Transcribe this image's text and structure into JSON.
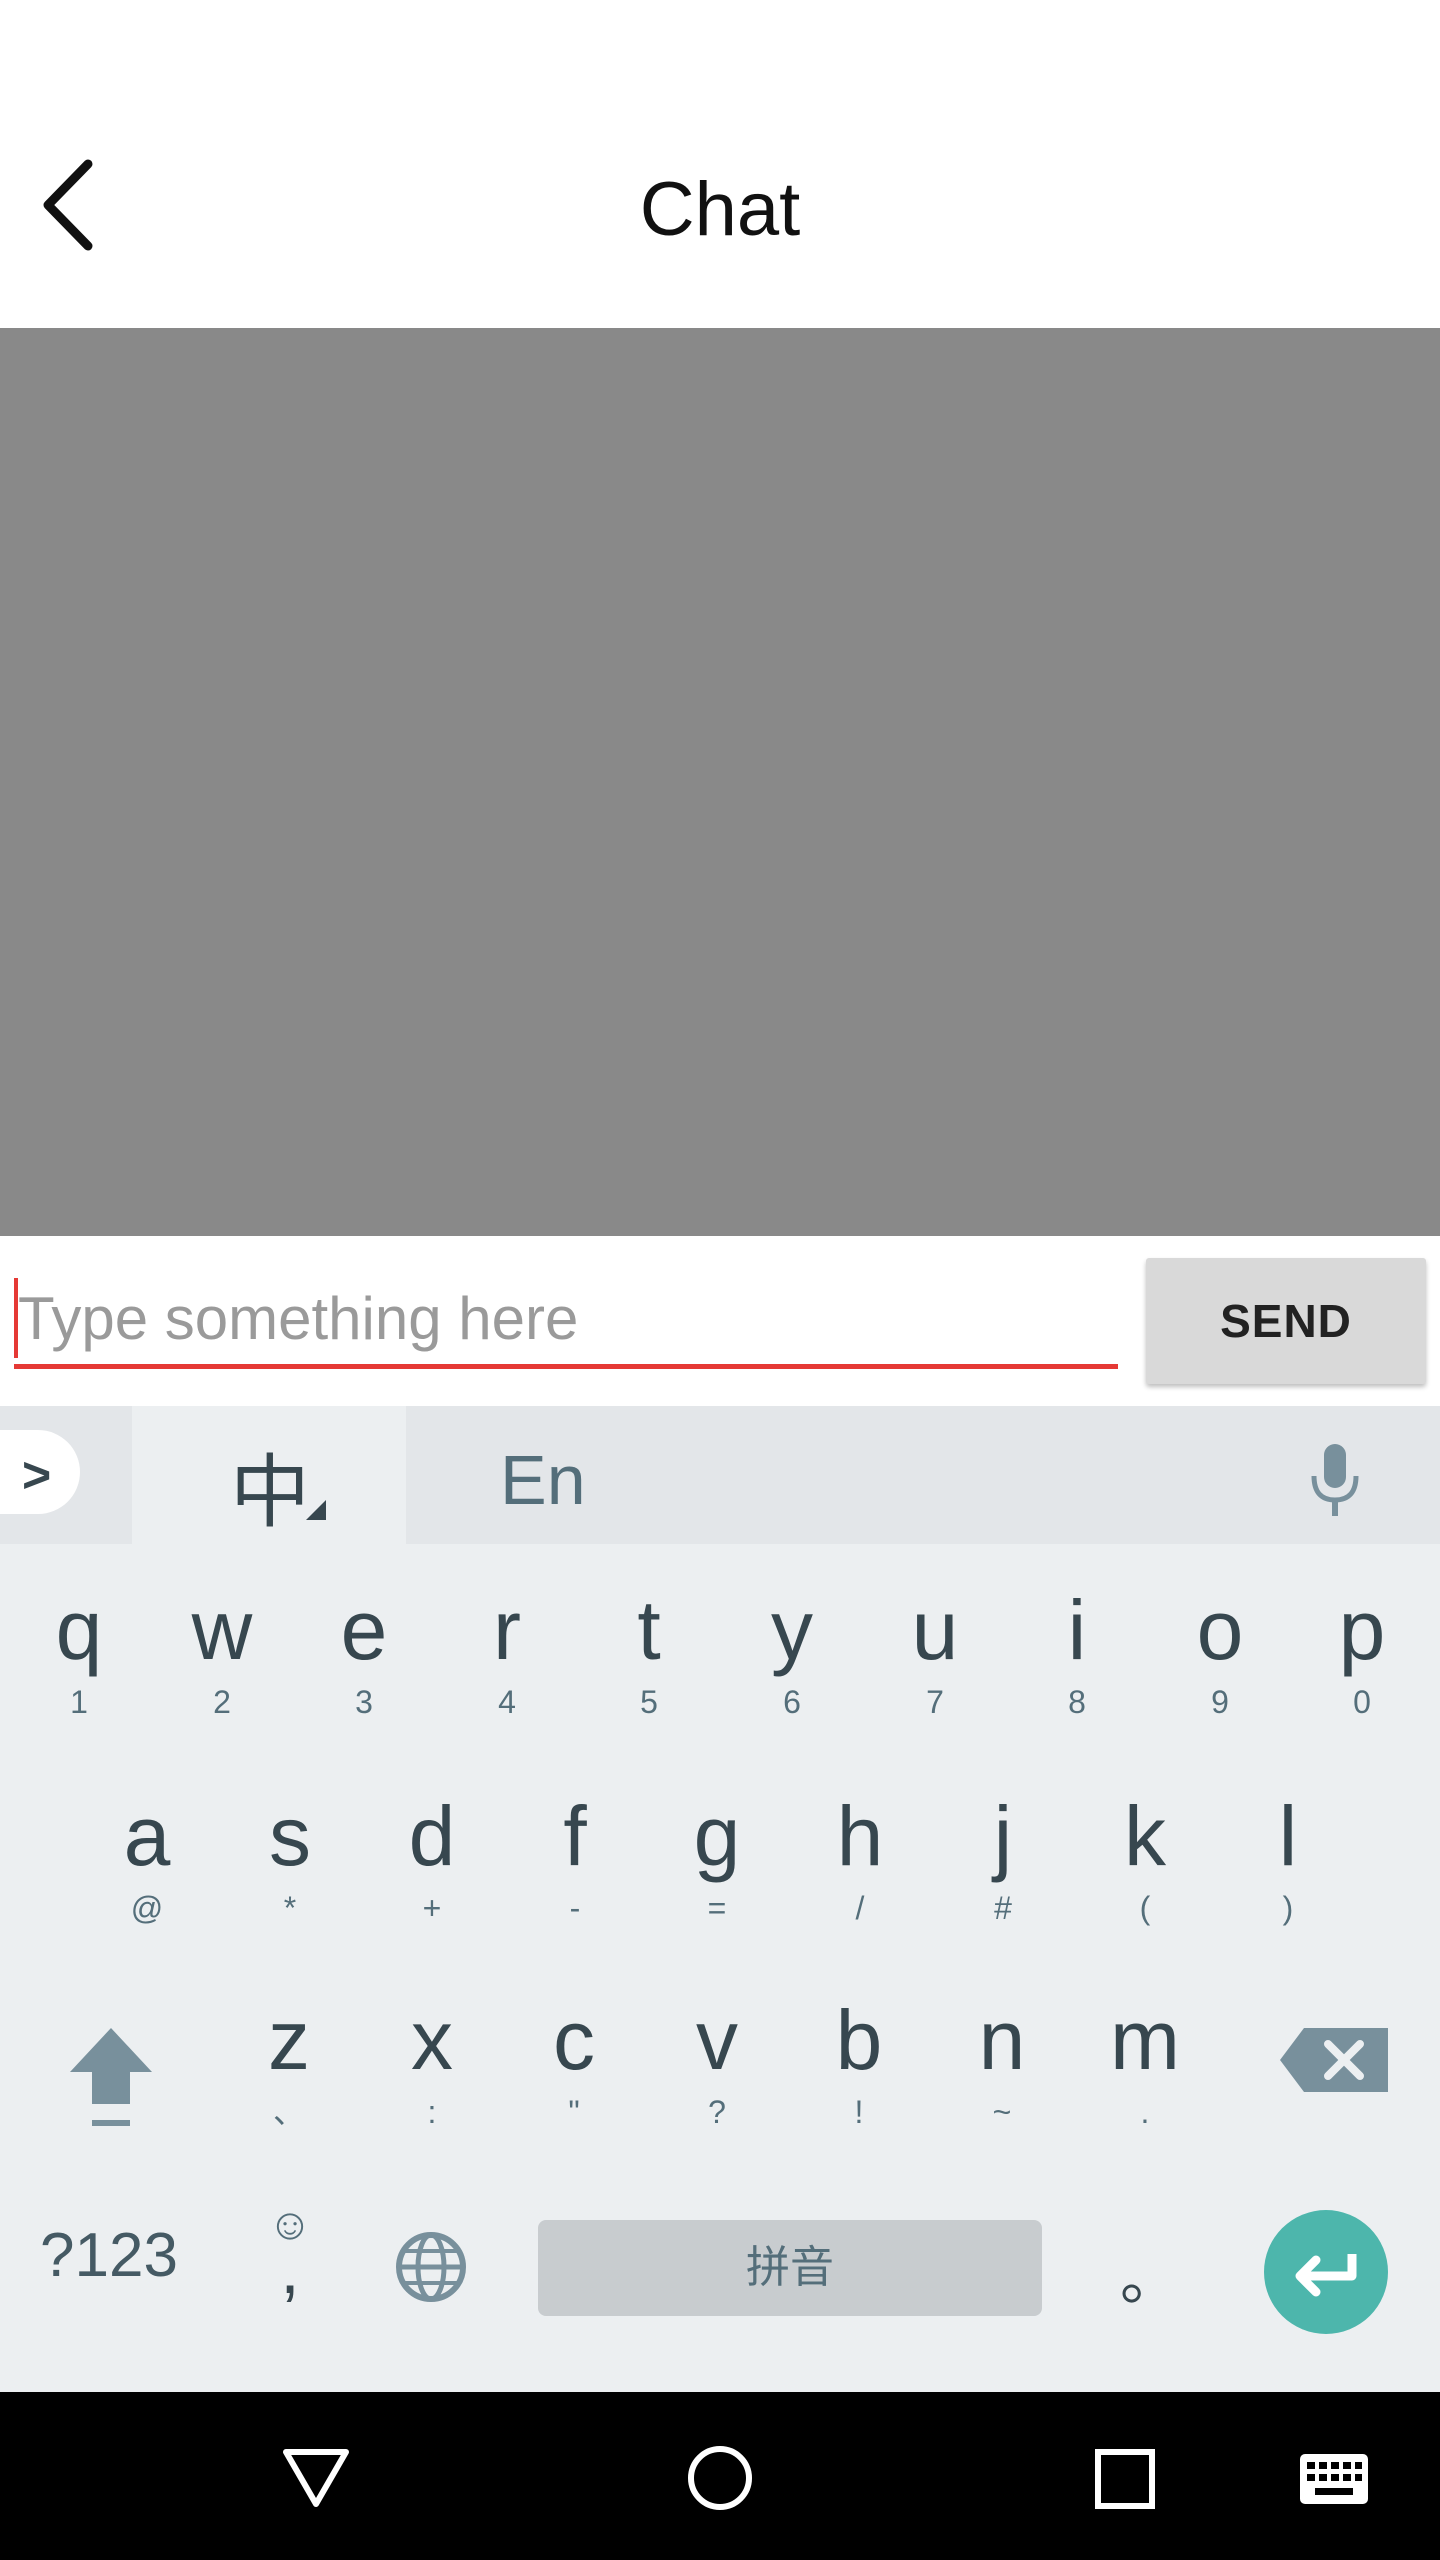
{
  "header": {
    "title": "Chat"
  },
  "composer": {
    "placeholder": "Type something here",
    "send_label": "SEND"
  },
  "keyboard": {
    "lang_zh": "中",
    "lang_en": "En",
    "row1": [
      {
        "key": "q",
        "sub": "1"
      },
      {
        "key": "w",
        "sub": "2"
      },
      {
        "key": "e",
        "sub": "3"
      },
      {
        "key": "r",
        "sub": "4"
      },
      {
        "key": "t",
        "sub": "5"
      },
      {
        "key": "y",
        "sub": "6"
      },
      {
        "key": "u",
        "sub": "7"
      },
      {
        "key": "i",
        "sub": "8"
      },
      {
        "key": "o",
        "sub": "9"
      },
      {
        "key": "p",
        "sub": "0"
      }
    ],
    "row2": [
      {
        "key": "a",
        "sub": "@"
      },
      {
        "key": "s",
        "sub": "*"
      },
      {
        "key": "d",
        "sub": "+"
      },
      {
        "key": "f",
        "sub": "-"
      },
      {
        "key": "g",
        "sub": "="
      },
      {
        "key": "h",
        "sub": "/"
      },
      {
        "key": "j",
        "sub": "#"
      },
      {
        "key": "k",
        "sub": "("
      },
      {
        "key": "l",
        "sub": ")"
      }
    ],
    "row3": [
      {
        "key": "z",
        "sub": "、"
      },
      {
        "key": "x",
        "sub": ":"
      },
      {
        "key": "c",
        "sub": "\""
      },
      {
        "key": "v",
        "sub": "?"
      },
      {
        "key": "b",
        "sub": "!"
      },
      {
        "key": "n",
        "sub": "~"
      },
      {
        "key": "m",
        "sub": "."
      }
    ],
    "sym_label": "?123",
    "emoji_glyph": "☺",
    "comma": ",",
    "space_label": "拼音",
    "period": "。"
  },
  "colors": {
    "accent": "#e53935",
    "enter": "#4db6ac",
    "chat_bg": "#898989"
  },
  "icons": [
    "back-icon",
    "chevron-right-icon",
    "mic-icon",
    "shift-icon",
    "backspace-icon",
    "globe-icon",
    "enter-icon",
    "nav-back-icon",
    "nav-home-icon",
    "nav-recents-icon",
    "nav-keyboard-icon"
  ]
}
